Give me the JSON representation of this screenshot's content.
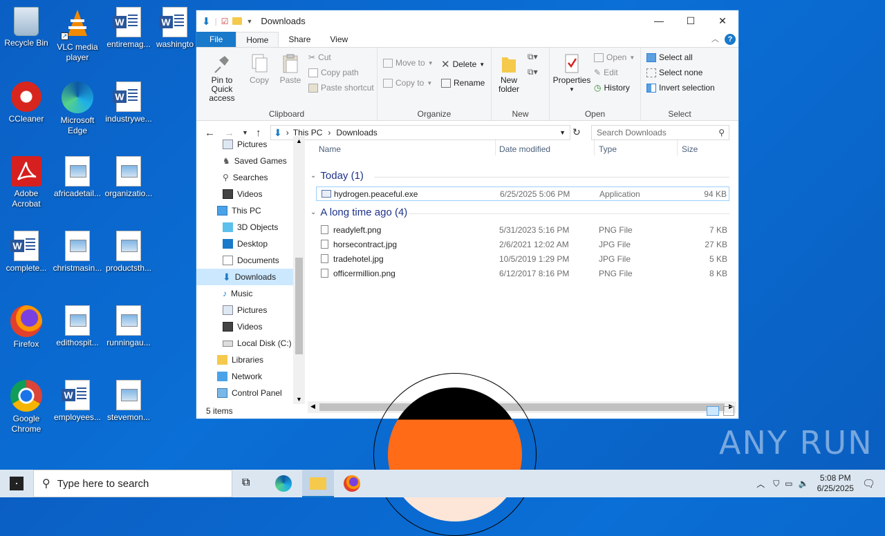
{
  "desktop": {
    "icons": [
      {
        "label": "Recycle Bin"
      },
      {
        "label": "VLC media player"
      },
      {
        "label": "entiremag..."
      },
      {
        "label": "washingto"
      },
      {
        "label": "CCleaner"
      },
      {
        "label": "Microsoft Edge"
      },
      {
        "label": "industrywe..."
      },
      {
        "label": "Adobe Acrobat"
      },
      {
        "label": "africadetail..."
      },
      {
        "label": "organizatio..."
      },
      {
        "label": "complete..."
      },
      {
        "label": "christmasin..."
      },
      {
        "label": "productsth..."
      },
      {
        "label": "Firefox"
      },
      {
        "label": "edithospit..."
      },
      {
        "label": "runningau..."
      },
      {
        "label": "Google Chrome"
      },
      {
        "label": "employees..."
      },
      {
        "label": "stevemon..."
      }
    ]
  },
  "explorer": {
    "title": "Downloads",
    "tabs": {
      "file": "File",
      "home": "Home",
      "share": "Share",
      "view": "View"
    },
    "clipboard": {
      "pin": "Pin to Quick access",
      "copy": "Copy",
      "paste": "Paste",
      "cut": "Cut",
      "copy_path": "Copy path",
      "paste_shortcut": "Paste shortcut",
      "label": "Clipboard"
    },
    "organize": {
      "move_to": "Move to",
      "copy_to": "Copy to",
      "delete": "Delete",
      "rename": "Rename",
      "label": "Organize"
    },
    "new": {
      "new_folder": "New folder",
      "label": "New"
    },
    "open": {
      "properties": "Properties",
      "open": "Open",
      "edit": "Edit",
      "history": "History",
      "label": "Open"
    },
    "select": {
      "select_all": "Select all",
      "select_none": "Select none",
      "invert": "Invert selection",
      "label": "Select"
    },
    "address": {
      "this_pc": "This PC",
      "downloads": "Downloads"
    },
    "search_placeholder": "Search Downloads",
    "nav": [
      "Pictures",
      "Saved Games",
      "Searches",
      "Videos",
      "This PC",
      "3D Objects",
      "Desktop",
      "Documents",
      "Downloads",
      "Music",
      "Pictures",
      "Videos",
      "Local Disk (C:)",
      "Libraries",
      "Network",
      "Control Panel"
    ],
    "columns": {
      "name": "Name",
      "date": "Date modified",
      "type": "Type",
      "size": "Size"
    },
    "groups": {
      "today": "Today (1)",
      "longago": "A long time ago (4)"
    },
    "files": [
      {
        "name": "hydrogen.peaceful.exe",
        "date": "6/25/2025 5:06 PM",
        "type": "Application",
        "size": "94 KB"
      },
      {
        "name": "readyleft.png",
        "date": "5/31/2023 5:16 PM",
        "type": "PNG File",
        "size": "7 KB"
      },
      {
        "name": "horsecontract.jpg",
        "date": "2/6/2021 12:02 AM",
        "type": "JPG File",
        "size": "27 KB"
      },
      {
        "name": "tradehotel.jpg",
        "date": "10/5/2019 1:29 PM",
        "type": "JPG File",
        "size": "5 KB"
      },
      {
        "name": "officermillion.png",
        "date": "6/12/2017 8:16 PM",
        "type": "PNG File",
        "size": "8 KB"
      }
    ],
    "status": "5 items"
  },
  "taskbar": {
    "search_placeholder": "Type here to search",
    "time": "5:08 PM",
    "date": "6/25/2025"
  },
  "watermark": "ANY RUN"
}
